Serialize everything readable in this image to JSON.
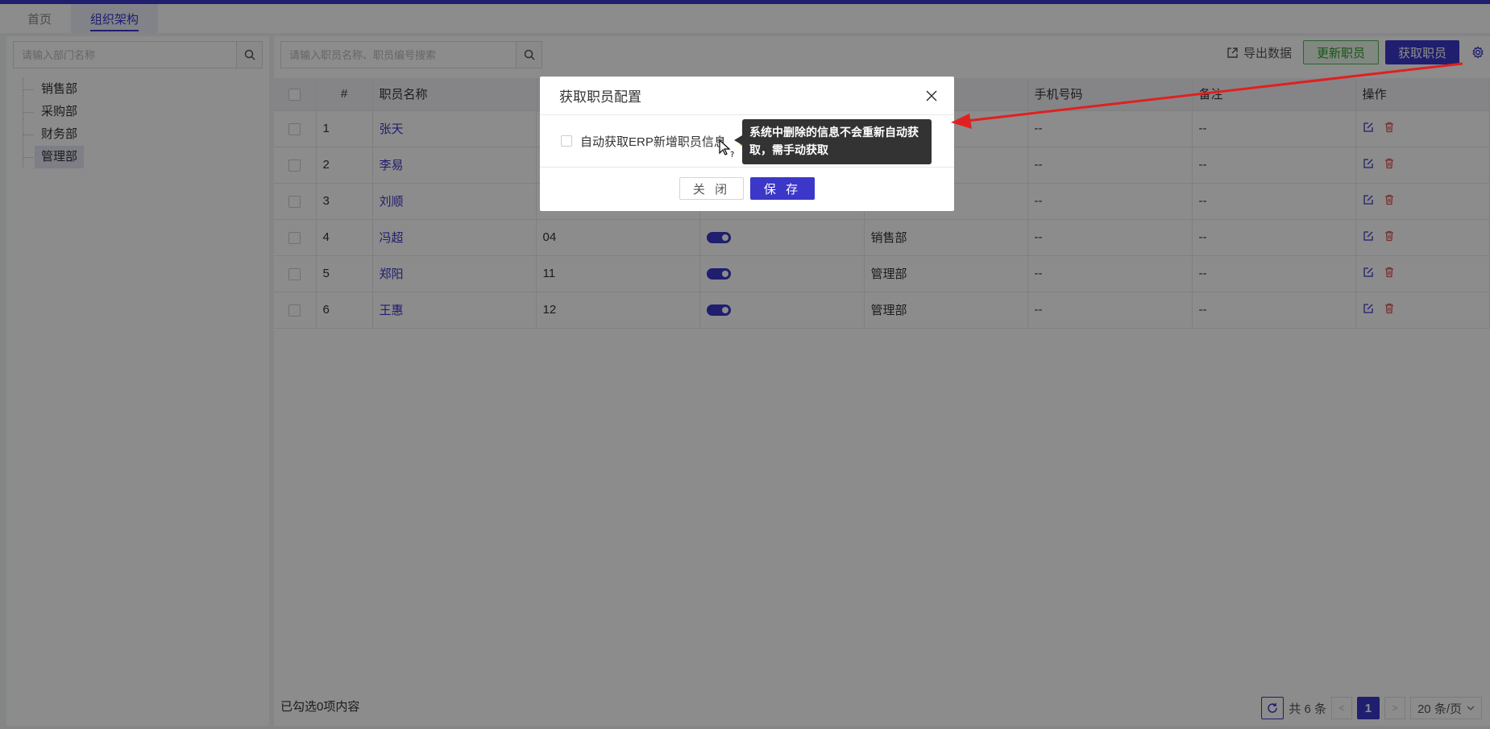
{
  "tabs": [
    {
      "label": "首页",
      "active": false
    },
    {
      "label": "组织架构",
      "active": true
    }
  ],
  "left_panel": {
    "search_placeholder": "请输入部门名称",
    "departments": [
      "销售部",
      "采购部",
      "财务部",
      "管理部"
    ],
    "selected": "管理部"
  },
  "main": {
    "search_placeholder": "请输入职员名称、职员编号搜索",
    "toolbar": {
      "export_label": "导出数据",
      "update_label": "更新职员",
      "fetch_label": "获取职员"
    },
    "columns": [
      "",
      "#",
      "职员名称",
      "",
      "",
      "",
      "手机号码",
      "备注",
      "操作"
    ],
    "rows": [
      {
        "idx": "1",
        "name": "张天",
        "code": "",
        "dept": "",
        "phone": "--",
        "note": "--",
        "show_toggle": false
      },
      {
        "idx": "2",
        "name": "李易",
        "code": "",
        "dept": "",
        "phone": "--",
        "note": "--",
        "show_toggle": false
      },
      {
        "idx": "3",
        "name": "刘顺",
        "code": "",
        "dept": "",
        "phone": "--",
        "note": "--",
        "show_toggle": false
      },
      {
        "idx": "4",
        "name": "冯超",
        "code": "04",
        "dept": "销售部",
        "phone": "--",
        "note": "--",
        "show_toggle": true
      },
      {
        "idx": "5",
        "name": "郑阳",
        "code": "11",
        "dept": "管理部",
        "phone": "--",
        "note": "--",
        "show_toggle": true
      },
      {
        "idx": "6",
        "name": "王惠",
        "code": "12",
        "dept": "管理部",
        "phone": "--",
        "note": "--",
        "show_toggle": true
      }
    ],
    "footer": {
      "selected_text": "已勾选0项内容",
      "total_text": "共 6 条",
      "current_page": "1",
      "page_size": "20 条/页"
    }
  },
  "dialog": {
    "title": "获取职员配置",
    "checkbox_label": "自动获取ERP新增职员信息",
    "close_label": "关 闭",
    "save_label": "保 存"
  },
  "tooltip": {
    "text": "系统中删除的信息不会重新自动获取，需手动获取"
  },
  "colors": {
    "primary": "#3b37c8",
    "success": "#52b452",
    "danger": "#e05555",
    "annotation_arrow": "#e02020"
  }
}
